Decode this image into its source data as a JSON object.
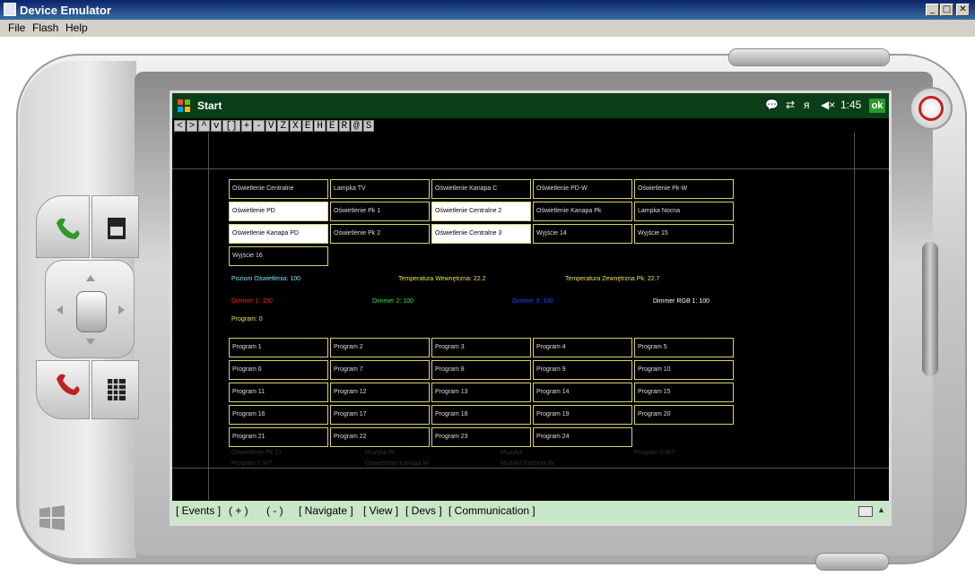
{
  "window": {
    "title": "Device Emulator",
    "controls": {
      "minimize": "_",
      "maximize": "□",
      "close": "✕"
    }
  },
  "menu": {
    "file": "File",
    "flash": "Flash",
    "help": "Help"
  },
  "taskbar": {
    "start": "Start",
    "time": "1:45",
    "ok": "ok",
    "icons": [
      "notification-icon",
      "connectivity-icon",
      "signal-off-icon",
      "volume-muted-icon"
    ]
  },
  "toolbar": [
    "<",
    ">",
    "^",
    "v",
    "[]",
    "+",
    "-",
    "V",
    "Z",
    "X",
    "E",
    "H",
    "E",
    "R",
    "@",
    "S"
  ],
  "buttons": [
    {
      "label": "Oświetlenie Centralne",
      "active": false
    },
    {
      "label": "Lampka TV",
      "active": false
    },
    {
      "label": "Oświetlenie Kanapa C",
      "active": false
    },
    {
      "label": "Oświetlenie PD-W",
      "active": false
    },
    {
      "label": "Oświetlenie Pk-W",
      "active": false
    },
    {
      "label": "Oświetlenie PD",
      "active": true
    },
    {
      "label": "Oświetlenie Pk 1",
      "active": false
    },
    {
      "label": "Oświetlenie Centralne 2",
      "active": true
    },
    {
      "label": "Oświetlenie Kanapa Pk",
      "active": false
    },
    {
      "label": "Lampka Nocna",
      "active": false
    },
    {
      "label": "Oświetlenie Kanapa PD",
      "active": true
    },
    {
      "label": "Oświetlenie Pk 2",
      "active": false
    },
    {
      "label": "Oświetlenie Centralne 3",
      "active": true
    },
    {
      "label": "Wyjście 14",
      "active": false
    },
    {
      "label": "Wyjście 15",
      "active": false
    },
    {
      "label": "Wyjście 16",
      "active": false
    }
  ],
  "info": {
    "poziom": "Poziom Oświetlenia: 100",
    "temp_in": "Temperatura Wewnętrzna: 22.2",
    "temp_out": "Temperatura Zewnętrzna Pk: 22.7",
    "dimmer1": "Dimmer 1: 100",
    "dimmer2": "Dimmer 2: 100",
    "dimmer3": "Dimmer 3: 100",
    "dimmer_rgb": "Dimmer RGB 1: 100",
    "program": "Program: 0",
    "colors": {
      "poziom": "#7fe0ff",
      "temp_in": "#f0e060",
      "temp_out": "#f0e060",
      "dimmer1": "#ff2020",
      "dimmer2": "#40e040",
      "dimmer3": "#3040ff",
      "dimmer_rgb": "#ffffff",
      "program": "#f0e060"
    }
  },
  "programs": [
    "Program 1",
    "Program 2",
    "Program 3",
    "Program 4",
    "Program 5",
    "Program 6",
    "Program 7",
    "Program 8",
    "Program 9",
    "Program 10",
    "Program 11",
    "Program 12",
    "Program 13",
    "Program 14",
    "Program 15",
    "Program 16",
    "Program 17",
    "Program 18",
    "Program 19",
    "Program 20",
    "Program 21",
    "Program 22",
    "Program 23",
    "Program 24"
  ],
  "ghost": [
    "Oświetlenie Pk 1?",
    "Muzyka W",
    "Muzyka",
    "Program 5 W?",
    "Program 6 W?",
    "Oświetlenie Kanapa W",
    "Muzyka Kuchnia W"
  ],
  "bottombar": {
    "events": "[ Events ]",
    "plus": "(   +   )",
    "minus": "(   -   )",
    "navigate": "[ Navigate ]",
    "view": "[ View ]",
    "devs": "[ Devs ]",
    "communication": "[ Communication ]"
  }
}
